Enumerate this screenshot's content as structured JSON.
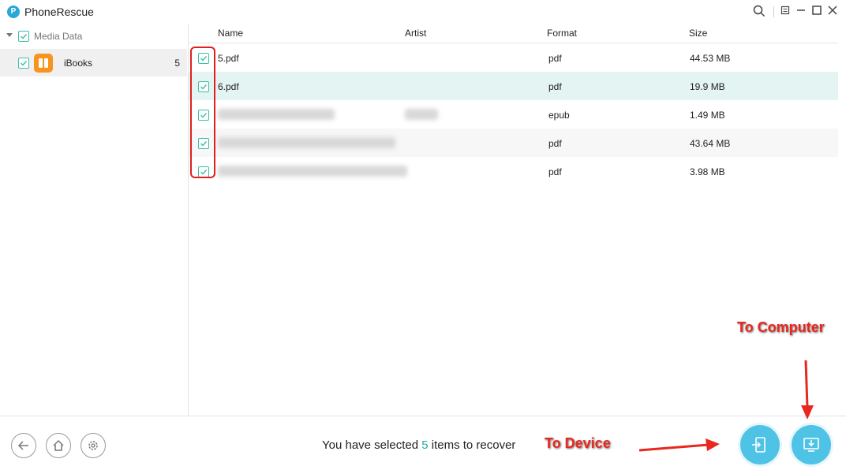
{
  "app": {
    "logo_glyph": "P",
    "title": "PhoneRescue"
  },
  "window_controls": [
    "search-icon",
    "menu-icon",
    "minimize-icon",
    "maximize-icon",
    "close-icon"
  ],
  "sidebar": {
    "group": {
      "label": "Media Data",
      "checked": true
    },
    "items": [
      {
        "label": "iBooks",
        "count": "5",
        "checked": true,
        "icon": "ibooks-icon"
      }
    ]
  },
  "table": {
    "columns": [
      "Name",
      "Artist",
      "Format",
      "Size"
    ],
    "rows": [
      {
        "name": "5.pdf",
        "artist": "",
        "format": "pdf",
        "size": "44.53 MB",
        "checked": true
      },
      {
        "name": "6.pdf",
        "artist": "",
        "format": "pdf",
        "size": "19.9 MB",
        "checked": true
      },
      {
        "name": "",
        "artist": "",
        "format": "epub",
        "size": "1.49 MB",
        "checked": true,
        "name_redacted": true,
        "artist_redacted": true
      },
      {
        "name": "",
        "artist": "",
        "format": "pdf",
        "size": "43.64 MB",
        "checked": true,
        "name_redacted": true
      },
      {
        "name": "",
        "artist": "",
        "format": "pdf",
        "size": "3.98 MB",
        "checked": true,
        "name_redacted": true
      }
    ]
  },
  "status": {
    "prefix": "You have selected ",
    "count": "5",
    "suffix": " items to recover"
  },
  "bottom_nav": [
    "back-icon",
    "home-icon",
    "settings-icon"
  ],
  "actions": {
    "to_device_label": "To Device",
    "to_computer_label": "To Computer"
  },
  "colors": {
    "accent": "#4fc3e6",
    "check": "#3bbfa5",
    "selected_row": "#e3f4f2",
    "annotation": "#e8281e"
  }
}
